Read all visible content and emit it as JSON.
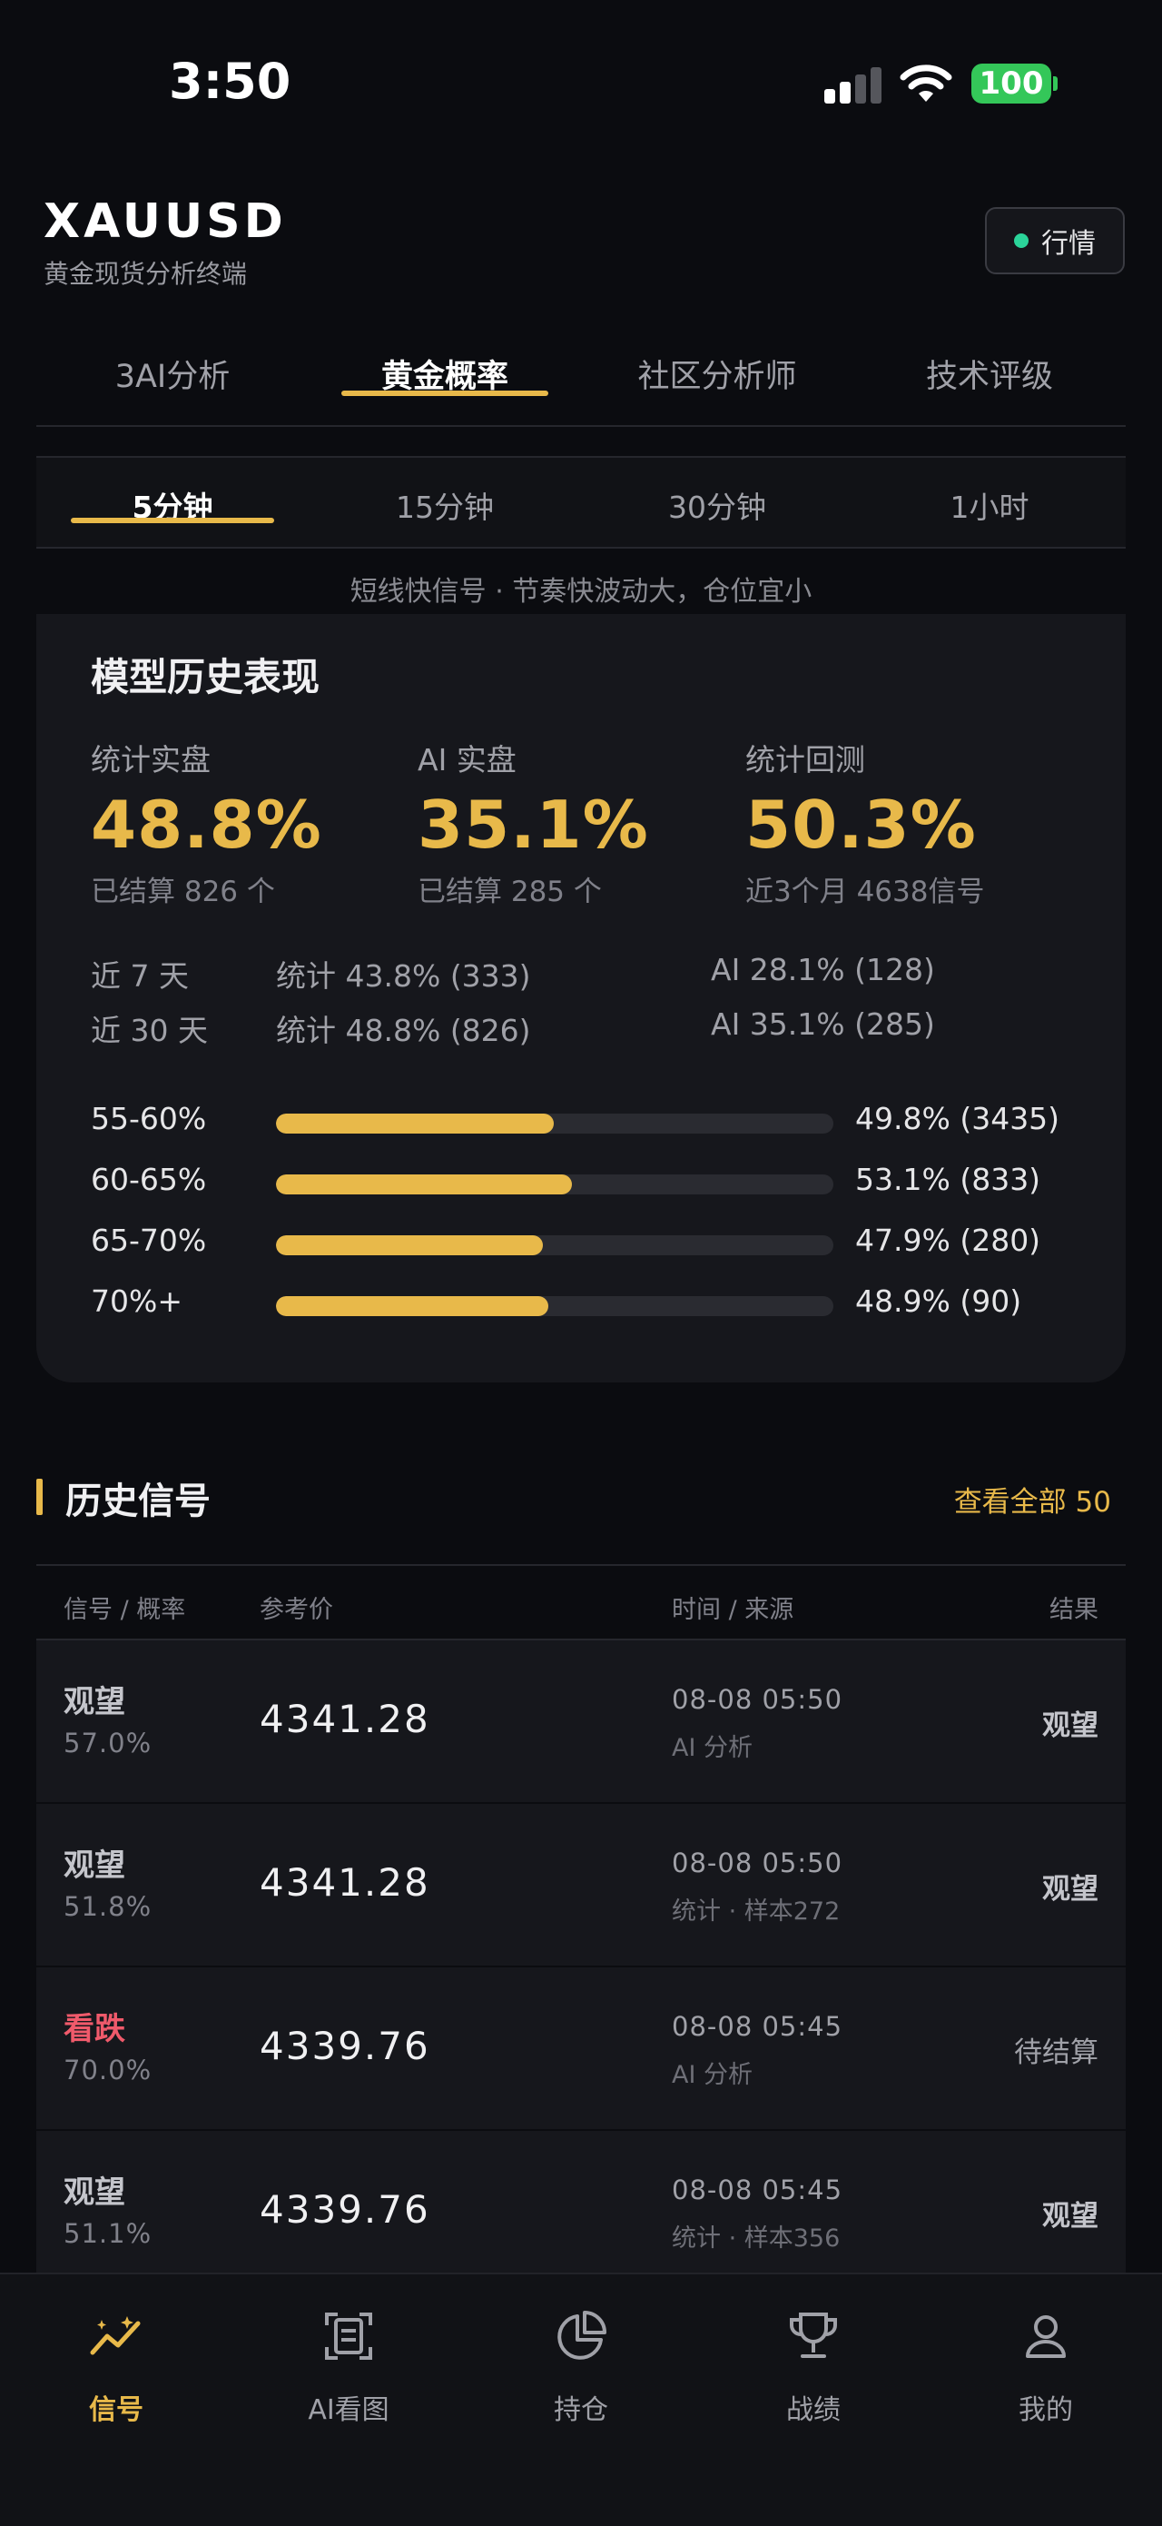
{
  "status": {
    "time": "3:50",
    "battery": "100"
  },
  "header": {
    "title": "XAUUSD",
    "subtitle": "黄金现货分析终端",
    "market_button": "行情"
  },
  "main_tabs": [
    {
      "label": "3AI分析",
      "active": false
    },
    {
      "label": "黄金概率",
      "active": true
    },
    {
      "label": "社区分析师",
      "active": false
    },
    {
      "label": "技术评级",
      "active": false
    }
  ],
  "time_tabs": [
    {
      "label": "5分钟",
      "active": true
    },
    {
      "label": "15分钟",
      "active": false
    },
    {
      "label": "30分钟",
      "active": false
    },
    {
      "label": "1小时",
      "active": false
    }
  ],
  "hint": "短线快信号 · 节奏快波动大，仓位宜小",
  "performance": {
    "title": "模型历史表现",
    "stats": [
      {
        "label": "统计实盘",
        "value": "48.8%",
        "sub": "已结算 826 个"
      },
      {
        "label": "AI 实盘",
        "value": "35.1%",
        "sub": "已结算 285 个"
      },
      {
        "label": "统计回测",
        "value": "50.3%",
        "sub": "近3个月 4638信号"
      }
    ],
    "recent": [
      {
        "period": "近 7 天",
        "stat": "统计 43.8% (333)",
        "ai": "AI 28.1% (128)"
      },
      {
        "period": "近 30 天",
        "stat": "统计 48.8% (826)",
        "ai": "AI 35.1% (285)"
      }
    ],
    "ranges": [
      {
        "label": "55-60%",
        "value": "49.8% (3435)",
        "fill": 0.498
      },
      {
        "label": "60-65%",
        "value": "53.1% (833)",
        "fill": 0.531
      },
      {
        "label": "65-70%",
        "value": "47.9% (280)",
        "fill": 0.479
      },
      {
        "label": "70%+",
        "value": "48.9% (90)",
        "fill": 0.489
      }
    ]
  },
  "history": {
    "title": "历史信号",
    "view_all": "查看全部 50",
    "columns": [
      "信号 / 概率",
      "参考价",
      "时间 / 来源",
      "结果"
    ],
    "rows": [
      {
        "signal": "观望",
        "prob": "57.0%",
        "price": "4341.28",
        "time": "08-08 05:50",
        "source": "AI 分析",
        "result": "观望"
      },
      {
        "signal": "观望",
        "prob": "51.8%",
        "price": "4341.28",
        "time": "08-08 05:50",
        "source": "统计 · 样本272",
        "result": "观望"
      },
      {
        "signal": "看跌",
        "prob": "70.0%",
        "price": "4339.76",
        "time": "08-08 05:45",
        "source": "AI 分析",
        "result": "待结算"
      },
      {
        "signal": "观望",
        "prob": "51.1%",
        "price": "4339.76",
        "time": "08-08 05:45",
        "source": "统计 · 样本356",
        "result": "观望"
      }
    ]
  },
  "nav": [
    {
      "label": "信号",
      "icon": "signal-chart-icon",
      "active": true
    },
    {
      "label": "AI看图",
      "icon": "scan-document-icon",
      "active": false
    },
    {
      "label": "持仓",
      "icon": "pie-chart-icon",
      "active": false
    },
    {
      "label": "战绩",
      "icon": "trophy-icon",
      "active": false
    },
    {
      "label": "我的",
      "icon": "user-icon",
      "active": false
    }
  ],
  "colors": {
    "accent": "#e8b94a",
    "down": "#f05a6b",
    "online": "#2bd49a",
    "battery": "#34c759"
  }
}
